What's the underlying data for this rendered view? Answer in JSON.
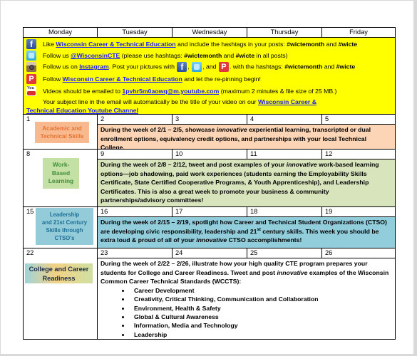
{
  "calendar": {
    "days": [
      "Monday",
      "Tuesday",
      "Wednesday",
      "Thursday",
      "Friday"
    ],
    "info": {
      "colors": {
        "background": "#ffff00",
        "link": "#1a1aff"
      },
      "facebook": {
        "icon": "facebook-icon",
        "pre": "Like ",
        "link": "Wisconsin Career & Technical Education",
        "mid": " and include the hashtags in your posts: ",
        "tag1": "#wictemonth",
        "and": " and ",
        "tag2": "#wicte"
      },
      "twitter": {
        "icon": "twitter-icon",
        "pre": "Follow us ",
        "link": "@WisconsinCTE",
        "mid": " (please use hashtags: ",
        "tag1": "#wictemonth",
        "and": " and ",
        "tag2": "#wicte",
        "post": " in all posts)"
      },
      "instagram": {
        "icon": "instagram-icon",
        "pre": "Follow us on ",
        "link": "Instagram",
        "mid": ". Post your pictures with ",
        "comma": ", ",
        "and_text": ", and ",
        "post": ". with the hashtags: ",
        "tag1": "#wictemonth",
        "and": " and ",
        "tag2": "#wicte"
      },
      "pinterest": {
        "icon": "pinterest-icon",
        "pre": "Follow ",
        "link": "Wisconsin Career & Technical Education",
        "post": " and let the re-pinning begin!"
      },
      "youtube": {
        "icon": "youtube-icon",
        "pre": "Videos should be emailed to ",
        "email": "1pvhr5m0aowq@m.youtube.com",
        "post": " (maximum 2 minutes & file size of 25 MB.)",
        "line2": "Your subject line in the email will automatically be the title of your video on our ",
        "link_part1": "Wisconsin Career &",
        "link_part2": "Technical Education Youtube Channel"
      }
    },
    "weeks": [
      {
        "monday": "1",
        "days": [
          "2",
          "3",
          "4",
          "5"
        ],
        "badge": [
          "Academic and",
          "Technical Skills"
        ],
        "color": "#fbd5b5",
        "desc": {
          "a": "During the week of 2/1 – 2/5, showcase ",
          "em": "innovative",
          "b": " experiential learning, transcripted or dual enrollment options, equivalency credit options, and partnerships with your local Technical College."
        }
      },
      {
        "monday": "8",
        "days": [
          "9",
          "10",
          "11",
          "12"
        ],
        "badge": [
          "Work-",
          "Based",
          "Learning"
        ],
        "color": "#d8e4bc",
        "desc": {
          "a": "During the week of 2/8 – 2/12, tweet and post examples of your ",
          "em": "innovative",
          "b": " work-based learning options—job shadowing, paid work experiences (students earning the Employability Skills Certificate, State Certified Cooperative Programs, & Youth Apprenticeship), and Leadership Certificates.  This is also a great week to promote your business & community partnerships/advisory committees!"
        }
      },
      {
        "monday": "15",
        "days": [
          "16",
          "17",
          "18",
          "19"
        ],
        "badge": [
          "Leadership",
          "and 21st Century",
          "Skills through",
          "CTSO's"
        ],
        "color": "#92cddc",
        "desc": {
          "a": "During the week of 2/15 – 2/19, spotlight how Career and Technical Student Organizations (CTSO) are developing civic responsibility, leadership and 21",
          "sup": "st",
          "b": " century skills.  This week you should be extra loud & proud of all of your ",
          "em": "innovative",
          "c": " CTSO accomplishments!"
        }
      },
      {
        "monday": "22",
        "days": [
          "23",
          "24",
          "25",
          "26"
        ],
        "badge": [
          "College and Career",
          "Readiness"
        ],
        "color": "#ffffff",
        "desc": {
          "a": "During the week of 2/22 – 2/26, illustrate how your high quality CTE program prepares your students for College and Career Readiness. Tweet and post ",
          "em": "innovative",
          "b": " examples of the Wisconsin Common Career Technical Standards (WCCTS):"
        },
        "standards": [
          "Career Development",
          "Creativity, Critical Thinking, Communication and Collaboration",
          "Environment, Health & Safety",
          "Global & Cultural Awareness",
          "Information, Media and Technology",
          "Leadership"
        ]
      }
    ]
  }
}
